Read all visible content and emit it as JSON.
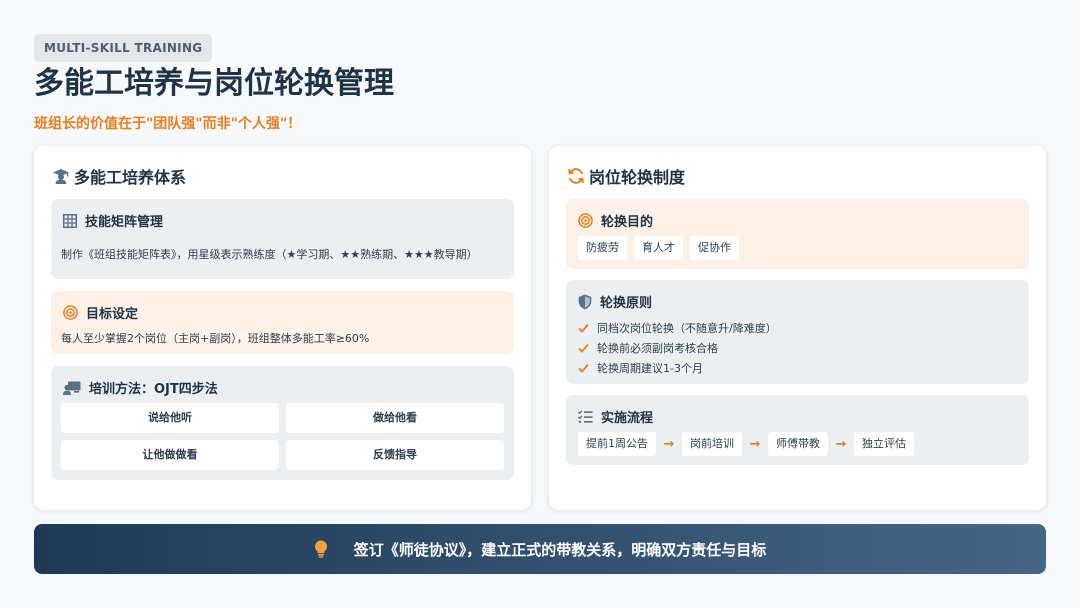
{
  "header": {
    "tag": "MULTI-SKILL TRAINING",
    "title": "多能工培养与岗位轮换管理",
    "subtitle": "班组长的价值在于\"团队强\"而非\"个人强\"！"
  },
  "left": {
    "title": "多能工培养体系",
    "icon": "graduate-icon",
    "cards": {
      "matrix": {
        "icon": "grid-icon",
        "title": "技能矩阵管理",
        "text": "制作《班组技能矩阵表》，用星级表示熟练度（★学习期、★★熟练期、★★★教导期）"
      },
      "goal": {
        "icon": "target-icon",
        "title": "目标设定",
        "text": "每人至少掌握2个岗位（主岗+副岗），班组整体多能工率≥60%"
      },
      "method": {
        "icon": "teacher-icon",
        "title": "培训方法：OJT四步法",
        "steps": [
          "说给他听",
          "做给他看",
          "让他做做看",
          "反馈指导"
        ]
      }
    }
  },
  "right": {
    "title": "岗位轮换制度",
    "icon": "rotate-icon",
    "cards": {
      "purpose": {
        "icon": "target-icon",
        "title": "轮换目的",
        "chips": [
          "防疲劳",
          "育人才",
          "促协作"
        ]
      },
      "principles": {
        "icon": "shield-icon",
        "title": "轮换原则",
        "items": [
          "同档次岗位轮换（不随意升/降难度）",
          "轮换前必须副岗考核合格",
          "轮换周期建议1-3个月"
        ]
      },
      "process": {
        "icon": "list-check-icon",
        "title": "实施流程",
        "steps": [
          "提前1周公告",
          "岗前培训",
          "师傅带教",
          "独立评估"
        ],
        "arrow": "→"
      }
    }
  },
  "banner": {
    "icon": "lightbulb-icon",
    "text": "签订《师徒协议》，建立正式的带教关系，明确双方责任与目标"
  },
  "colors": {
    "accent": "#e67e22",
    "navy": "#1f3346",
    "steel": "#5a7189",
    "card_gray": "#eceff2",
    "card_warm": "#fdf1e7"
  }
}
